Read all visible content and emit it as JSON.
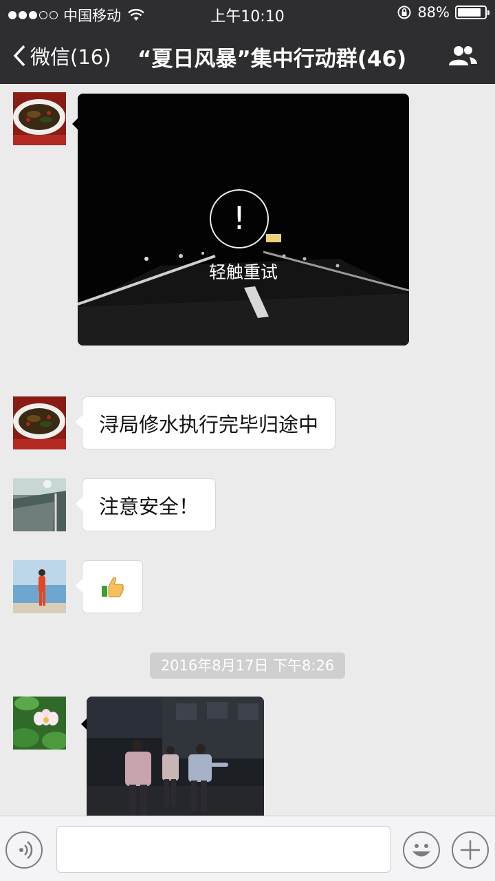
{
  "status_bar": {
    "carrier": "中国移动",
    "time": "上午10:10",
    "battery": "88%",
    "battery_level": 0.88,
    "signal_bars": 3
  },
  "nav": {
    "back_label": "微信(16)",
    "title": "“夏日风暴”集中行动群(46)"
  },
  "messages": {
    "image1": {
      "retry_label": "轻触重试"
    },
    "text1": "浔局修水执行完毕归途中",
    "text2": "注意安全！",
    "emoji": "thumbs-up",
    "timestamp": "2016年8月17日 下午8:26"
  },
  "input_bar": {
    "placeholder": ""
  },
  "colors": {
    "nav_bg": "#2e2e30",
    "chat_bg": "#ebebeb"
  }
}
